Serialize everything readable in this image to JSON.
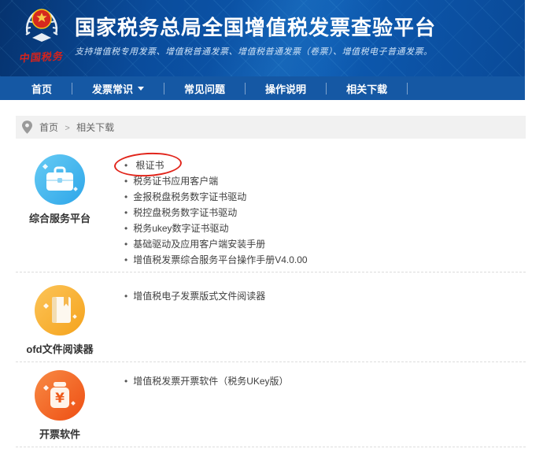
{
  "header": {
    "title": "国家税务总局全国增值税发票查验平台",
    "subtitle": "支持增值税专用发票、增值税普通发票、增值税普通发票（卷票）、增值税电子普通发票。",
    "logo": {
      "text": "中国税务"
    }
  },
  "nav": {
    "items": [
      "首页",
      "发票常识",
      "常见问题",
      "操作说明",
      "相关下载"
    ]
  },
  "breadcrumb": {
    "home": "首页",
    "separator": ">",
    "current": "相关下载"
  },
  "download_sections": [
    {
      "category": "综合服务平台",
      "icon": "toolbox-icon",
      "links": [
        "根证书",
        "税务证书应用客户端",
        "金报税盘税务数字证书驱动",
        "税控盘税务数字证书驱动",
        "税务ukey数字证书驱动",
        "基础驱动及应用客户端安装手册",
        "增值税发票综合服务平台操作手册V4.0.00"
      ]
    },
    {
      "category": "ofd文件阅读器",
      "icon": "book-icon",
      "links": [
        "增值税电子发票版式文件阅读器"
      ]
    },
    {
      "category": "开票软件",
      "icon": "money-jar-icon",
      "icon_glyph": "¥",
      "links": [
        "增值税发票开票软件（税务UKey版）"
      ]
    }
  ],
  "annotation": {
    "target": "根证书",
    "shape": "ellipse",
    "color": "#e1251b"
  },
  "colors": {
    "header_blue": "#0a4c9c",
    "nav_blue": "#1558a4",
    "icon_blue": "#2ea6e9",
    "icon_orange": "#f5a31c",
    "icon_red_orange": "#ee4e13",
    "annotation_red": "#e1251b",
    "breadcrumb_bg": "#f1f1f1",
    "link_text": "#404040"
  }
}
